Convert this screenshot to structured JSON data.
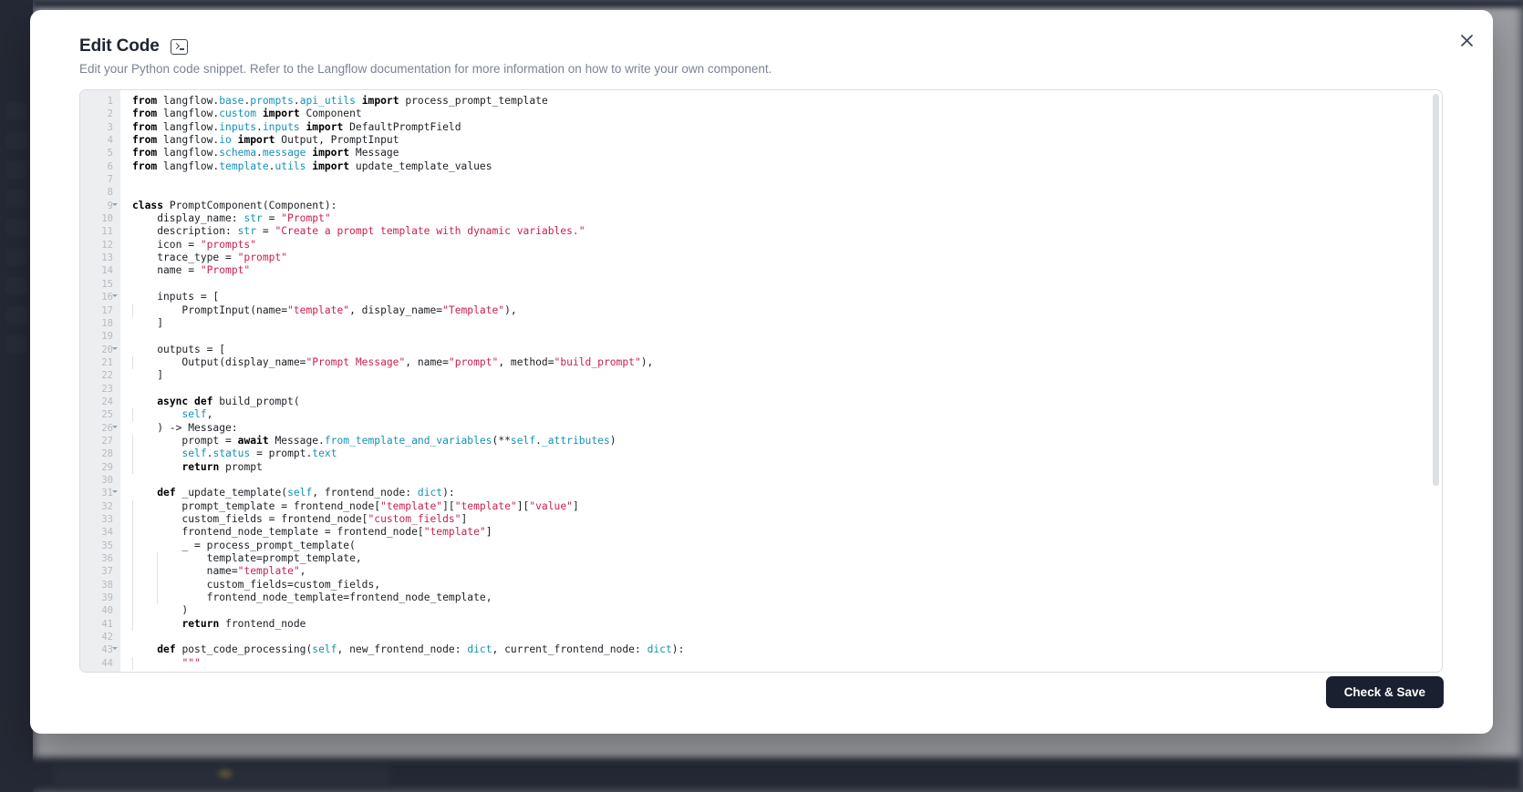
{
  "backdrop": {
    "sidebar_item_count": 9
  },
  "modal": {
    "title": "Edit Code",
    "title_icon": "terminal-icon",
    "subtitle": "Edit your Python code snippet. Refer to the Langflow documentation for more information on how to write your own component.",
    "close_icon": "close-icon",
    "save_label": "Check & Save",
    "accent_color": "#1b2030",
    "string_color": "#c9204f",
    "identifier_color": "#1391b5",
    "gutter_color": "#eceef0"
  },
  "editor": {
    "language": "python",
    "first_visible_line": 1,
    "last_visible_line": 44,
    "lines": [
      {
        "n": 1,
        "fold": false,
        "tokens": [
          {
            "t": "from ",
            "c": "kw"
          },
          {
            "t": "langflow.",
            "c": "plain"
          },
          {
            "t": "base",
            "c": "teal"
          },
          {
            "t": ".",
            "c": "plain"
          },
          {
            "t": "prompts",
            "c": "teal"
          },
          {
            "t": ".",
            "c": "plain"
          },
          {
            "t": "api_utils",
            "c": "teal"
          },
          {
            "t": " ",
            "c": "plain"
          },
          {
            "t": "import",
            "c": "kw"
          },
          {
            "t": " process_prompt_template",
            "c": "plain"
          }
        ]
      },
      {
        "n": 2,
        "fold": false,
        "tokens": [
          {
            "t": "from ",
            "c": "kw"
          },
          {
            "t": "langflow.",
            "c": "plain"
          },
          {
            "t": "custom",
            "c": "teal"
          },
          {
            "t": " ",
            "c": "plain"
          },
          {
            "t": "import",
            "c": "kw"
          },
          {
            "t": " Component",
            "c": "plain"
          }
        ]
      },
      {
        "n": 3,
        "fold": false,
        "tokens": [
          {
            "t": "from ",
            "c": "kw"
          },
          {
            "t": "langflow.",
            "c": "plain"
          },
          {
            "t": "inputs",
            "c": "teal"
          },
          {
            "t": ".",
            "c": "plain"
          },
          {
            "t": "inputs",
            "c": "teal"
          },
          {
            "t": " ",
            "c": "plain"
          },
          {
            "t": "import",
            "c": "kw"
          },
          {
            "t": " DefaultPromptField",
            "c": "plain"
          }
        ]
      },
      {
        "n": 4,
        "fold": false,
        "tokens": [
          {
            "t": "from ",
            "c": "kw"
          },
          {
            "t": "langflow.",
            "c": "plain"
          },
          {
            "t": "io",
            "c": "teal"
          },
          {
            "t": " ",
            "c": "plain"
          },
          {
            "t": "import",
            "c": "kw"
          },
          {
            "t": " Output, PromptInput",
            "c": "plain"
          }
        ]
      },
      {
        "n": 5,
        "fold": false,
        "tokens": [
          {
            "t": "from ",
            "c": "kw"
          },
          {
            "t": "langflow.",
            "c": "plain"
          },
          {
            "t": "schema",
            "c": "teal"
          },
          {
            "t": ".",
            "c": "plain"
          },
          {
            "t": "message",
            "c": "teal"
          },
          {
            "t": " ",
            "c": "plain"
          },
          {
            "t": "import",
            "c": "kw"
          },
          {
            "t": " Message",
            "c": "plain"
          }
        ]
      },
      {
        "n": 6,
        "fold": false,
        "tokens": [
          {
            "t": "from ",
            "c": "kw"
          },
          {
            "t": "langflow.",
            "c": "plain"
          },
          {
            "t": "template",
            "c": "teal"
          },
          {
            "t": ".",
            "c": "plain"
          },
          {
            "t": "utils",
            "c": "teal"
          },
          {
            "t": " ",
            "c": "plain"
          },
          {
            "t": "import",
            "c": "kw"
          },
          {
            "t": " update_template_values",
            "c": "plain"
          }
        ]
      },
      {
        "n": 7,
        "fold": false,
        "tokens": []
      },
      {
        "n": 8,
        "fold": false,
        "tokens": []
      },
      {
        "n": 9,
        "fold": true,
        "tokens": [
          {
            "t": "class ",
            "c": "kw"
          },
          {
            "t": "PromptComponent(Component):",
            "c": "plain"
          }
        ]
      },
      {
        "n": 10,
        "fold": false,
        "tokens": [
          {
            "t": "    display_name: ",
            "c": "plain"
          },
          {
            "t": "str",
            "c": "teal"
          },
          {
            "t": " = ",
            "c": "plain"
          },
          {
            "t": "\"Prompt\"",
            "c": "str"
          }
        ]
      },
      {
        "n": 11,
        "fold": false,
        "tokens": [
          {
            "t": "    description: ",
            "c": "plain"
          },
          {
            "t": "str",
            "c": "teal"
          },
          {
            "t": " = ",
            "c": "plain"
          },
          {
            "t": "\"Create a prompt template with dynamic variables.\"",
            "c": "str"
          }
        ]
      },
      {
        "n": 12,
        "fold": false,
        "tokens": [
          {
            "t": "    icon = ",
            "c": "plain"
          },
          {
            "t": "\"prompts\"",
            "c": "str"
          }
        ]
      },
      {
        "n": 13,
        "fold": false,
        "tokens": [
          {
            "t": "    trace_type = ",
            "c": "plain"
          },
          {
            "t": "\"prompt\"",
            "c": "str"
          }
        ]
      },
      {
        "n": 14,
        "fold": false,
        "tokens": [
          {
            "t": "    name = ",
            "c": "plain"
          },
          {
            "t": "\"Prompt\"",
            "c": "str"
          }
        ]
      },
      {
        "n": 15,
        "fold": false,
        "tokens": []
      },
      {
        "n": 16,
        "fold": true,
        "tokens": [
          {
            "t": "    inputs = [",
            "c": "plain"
          }
        ]
      },
      {
        "n": 17,
        "fold": false,
        "guide": 1,
        "tokens": [
          {
            "t": "        PromptInput(name=",
            "c": "plain"
          },
          {
            "t": "\"template\"",
            "c": "str"
          },
          {
            "t": ", display_name=",
            "c": "plain"
          },
          {
            "t": "\"Template\"",
            "c": "str"
          },
          {
            "t": "),",
            "c": "plain"
          }
        ]
      },
      {
        "n": 18,
        "fold": false,
        "tokens": [
          {
            "t": "    ]",
            "c": "plain"
          }
        ]
      },
      {
        "n": 19,
        "fold": false,
        "tokens": []
      },
      {
        "n": 20,
        "fold": true,
        "tokens": [
          {
            "t": "    outputs = [",
            "c": "plain"
          }
        ]
      },
      {
        "n": 21,
        "fold": false,
        "guide": 1,
        "tokens": [
          {
            "t": "        Output(display_name=",
            "c": "plain"
          },
          {
            "t": "\"Prompt Message\"",
            "c": "str"
          },
          {
            "t": ", name=",
            "c": "plain"
          },
          {
            "t": "\"prompt\"",
            "c": "str"
          },
          {
            "t": ", method=",
            "c": "plain"
          },
          {
            "t": "\"build_prompt\"",
            "c": "str"
          },
          {
            "t": "),",
            "c": "plain"
          }
        ]
      },
      {
        "n": 22,
        "fold": false,
        "tokens": [
          {
            "t": "    ]",
            "c": "plain"
          }
        ]
      },
      {
        "n": 23,
        "fold": false,
        "tokens": []
      },
      {
        "n": 24,
        "fold": false,
        "tokens": [
          {
            "t": "    ",
            "c": "plain"
          },
          {
            "t": "async def ",
            "c": "kw"
          },
          {
            "t": "build_prompt(",
            "c": "plain"
          }
        ]
      },
      {
        "n": 25,
        "fold": false,
        "guide": 1,
        "tokens": [
          {
            "t": "        ",
            "c": "plain"
          },
          {
            "t": "self",
            "c": "teal"
          },
          {
            "t": ",",
            "c": "plain"
          }
        ]
      },
      {
        "n": 26,
        "fold": true,
        "tokens": [
          {
            "t": "    ) -> Message:",
            "c": "plain"
          }
        ]
      },
      {
        "n": 27,
        "fold": false,
        "guide": 1,
        "tokens": [
          {
            "t": "        prompt = ",
            "c": "plain"
          },
          {
            "t": "await ",
            "c": "kw"
          },
          {
            "t": "Message.",
            "c": "plain"
          },
          {
            "t": "from_template_and_variables",
            "c": "teal"
          },
          {
            "t": "(**",
            "c": "plain"
          },
          {
            "t": "self",
            "c": "teal"
          },
          {
            "t": ".",
            "c": "plain"
          },
          {
            "t": "_attributes",
            "c": "teal"
          },
          {
            "t": ")",
            "c": "plain"
          }
        ]
      },
      {
        "n": 28,
        "fold": false,
        "guide": 1,
        "tokens": [
          {
            "t": "        ",
            "c": "plain"
          },
          {
            "t": "self",
            "c": "teal"
          },
          {
            "t": ".",
            "c": "plain"
          },
          {
            "t": "status",
            "c": "teal"
          },
          {
            "t": " = prompt.",
            "c": "plain"
          },
          {
            "t": "text",
            "c": "teal"
          }
        ]
      },
      {
        "n": 29,
        "fold": false,
        "guide": 1,
        "tokens": [
          {
            "t": "        ",
            "c": "plain"
          },
          {
            "t": "return ",
            "c": "kw"
          },
          {
            "t": "prompt",
            "c": "plain"
          }
        ]
      },
      {
        "n": 30,
        "fold": false,
        "tokens": []
      },
      {
        "n": 31,
        "fold": true,
        "tokens": [
          {
            "t": "    ",
            "c": "plain"
          },
          {
            "t": "def ",
            "c": "kw"
          },
          {
            "t": "_update_template(",
            "c": "plain"
          },
          {
            "t": "self",
            "c": "teal"
          },
          {
            "t": ", frontend_node: ",
            "c": "plain"
          },
          {
            "t": "dict",
            "c": "teal"
          },
          {
            "t": "):",
            "c": "plain"
          }
        ]
      },
      {
        "n": 32,
        "fold": false,
        "guide": 1,
        "tokens": [
          {
            "t": "        prompt_template = frontend_node[",
            "c": "plain"
          },
          {
            "t": "\"template\"",
            "c": "str"
          },
          {
            "t": "][",
            "c": "plain"
          },
          {
            "t": "\"template\"",
            "c": "str"
          },
          {
            "t": "][",
            "c": "plain"
          },
          {
            "t": "\"value\"",
            "c": "str"
          },
          {
            "t": "]",
            "c": "plain"
          }
        ]
      },
      {
        "n": 33,
        "fold": false,
        "guide": 1,
        "tokens": [
          {
            "t": "        custom_fields = frontend_node[",
            "c": "plain"
          },
          {
            "t": "\"custom_fields\"",
            "c": "str"
          },
          {
            "t": "]",
            "c": "plain"
          }
        ]
      },
      {
        "n": 34,
        "fold": false,
        "guide": 1,
        "tokens": [
          {
            "t": "        frontend_node_template = frontend_node[",
            "c": "plain"
          },
          {
            "t": "\"template\"",
            "c": "str"
          },
          {
            "t": "]",
            "c": "plain"
          }
        ]
      },
      {
        "n": 35,
        "fold": false,
        "guide": 1,
        "tokens": [
          {
            "t": "        _ = process_prompt_template(",
            "c": "plain"
          }
        ]
      },
      {
        "n": 36,
        "fold": false,
        "guide": 2,
        "tokens": [
          {
            "t": "            template=prompt_template,",
            "c": "plain"
          }
        ]
      },
      {
        "n": 37,
        "fold": false,
        "guide": 2,
        "tokens": [
          {
            "t": "            name=",
            "c": "plain"
          },
          {
            "t": "\"template\"",
            "c": "str"
          },
          {
            "t": ",",
            "c": "plain"
          }
        ]
      },
      {
        "n": 38,
        "fold": false,
        "guide": 2,
        "tokens": [
          {
            "t": "            custom_fields=custom_fields,",
            "c": "plain"
          }
        ]
      },
      {
        "n": 39,
        "fold": false,
        "guide": 2,
        "tokens": [
          {
            "t": "            frontend_node_template=frontend_node_template,",
            "c": "plain"
          }
        ]
      },
      {
        "n": 40,
        "fold": false,
        "guide": 1,
        "tokens": [
          {
            "t": "        )",
            "c": "plain"
          }
        ]
      },
      {
        "n": 41,
        "fold": false,
        "guide": 1,
        "tokens": [
          {
            "t": "        ",
            "c": "plain"
          },
          {
            "t": "return ",
            "c": "kw"
          },
          {
            "t": "frontend_node",
            "c": "plain"
          }
        ]
      },
      {
        "n": 42,
        "fold": false,
        "tokens": []
      },
      {
        "n": 43,
        "fold": true,
        "tokens": [
          {
            "t": "    ",
            "c": "plain"
          },
          {
            "t": "def ",
            "c": "kw"
          },
          {
            "t": "post_code_processing(",
            "c": "plain"
          },
          {
            "t": "self",
            "c": "teal"
          },
          {
            "t": ", new_frontend_node: ",
            "c": "plain"
          },
          {
            "t": "dict",
            "c": "teal"
          },
          {
            "t": ", current_frontend_node: ",
            "c": "plain"
          },
          {
            "t": "dict",
            "c": "teal"
          },
          {
            "t": "):",
            "c": "plain"
          }
        ]
      },
      {
        "n": 44,
        "fold": false,
        "guide": 1,
        "tokens": [
          {
            "t": "        ",
            "c": "plain"
          },
          {
            "t": "\"\"\"",
            "c": "str"
          }
        ]
      }
    ]
  }
}
